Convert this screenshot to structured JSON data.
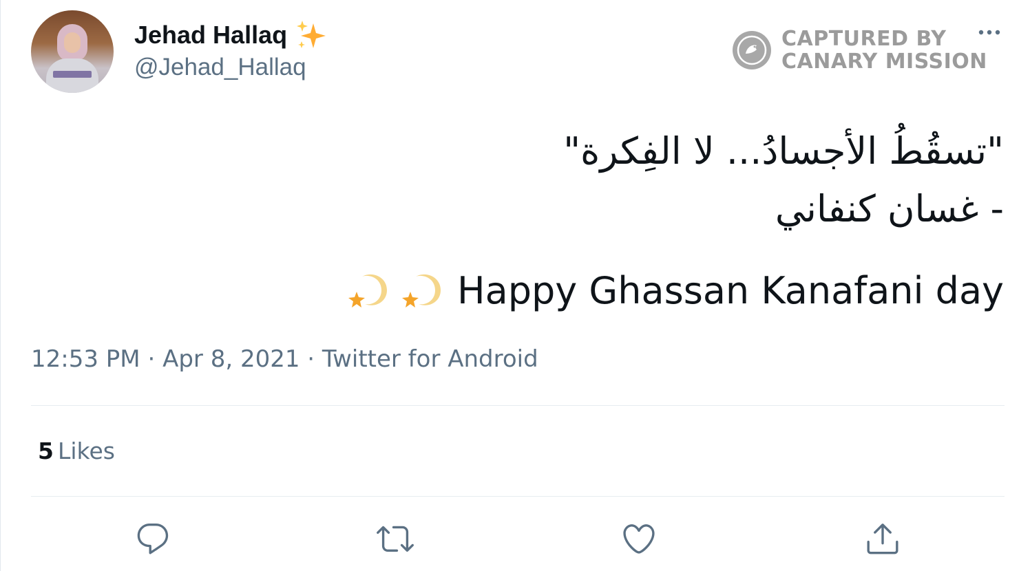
{
  "tweet": {
    "display_name": "Jehad Hallaq",
    "name_emoji": "sparkles-icon",
    "handle": "@Jehad_Hallaq",
    "arabic_lines": [
      "\"تسقُطُ الأجسادُ... لا الفِكرة\"",
      "- غسان كنفاني"
    ],
    "english_text": "Happy Ghassan Kanafani day",
    "trailing_emoji": [
      "dizzy-icon",
      "dizzy-icon"
    ],
    "time": "12:53 PM",
    "date": "Apr 8, 2021",
    "source": "Twitter for Android",
    "separator": "·",
    "likes_count": "5",
    "likes_label": "Likes"
  },
  "watermark": {
    "line1": "CAPTURED BY",
    "line2": "CANARY MISSION"
  },
  "actions": [
    "reply-icon",
    "retweet-icon",
    "like-icon",
    "share-icon"
  ],
  "colors": {
    "text_primary": "#0f1419",
    "text_secondary": "#5b7083",
    "divider": "#e6ecf0",
    "watermark": "#9b9b9b",
    "sparkle": "#ffac33"
  }
}
